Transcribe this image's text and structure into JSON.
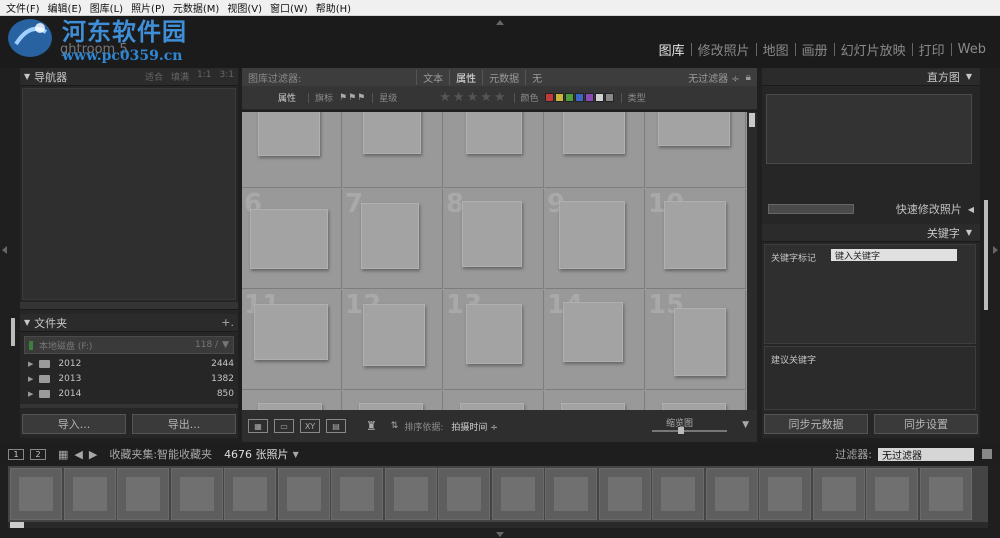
{
  "menu": [
    "文件(F)",
    "编辑(E)",
    "图库(L)",
    "照片(P)",
    "元数据(M)",
    "视图(V)",
    "窗口(W)",
    "帮助(H)"
  ],
  "logo": {
    "title": "河东软件园",
    "sub": "ghtroom 5",
    "url": "www.pc0359.cn"
  },
  "modules": [
    {
      "label": "图库",
      "active": true
    },
    {
      "label": "修改照片"
    },
    {
      "label": "地图"
    },
    {
      "label": "画册"
    },
    {
      "label": "幻灯片放映"
    },
    {
      "label": "打印"
    },
    {
      "label": "Web"
    }
  ],
  "left": {
    "navigator": "导航器",
    "nav_opts": [
      "适合",
      "填满",
      "1:1",
      "3:1"
    ],
    "folders": "文件夹",
    "volume": {
      "label": "本地磁盘 (F:)",
      "count": "118 /"
    },
    "folder_list": [
      {
        "name": "2012",
        "count": "2444"
      },
      {
        "name": "2013",
        "count": "1382"
      },
      {
        "name": "2014",
        "count": "850"
      }
    ],
    "import": "导入...",
    "export": "导出..."
  },
  "filter": {
    "title": "图库过滤器:",
    "tabs": [
      {
        "label": "文本"
      },
      {
        "label": "属性",
        "active": true
      },
      {
        "label": "元数据"
      },
      {
        "label": "无"
      }
    ],
    "preset": "无过滤器 ÷",
    "attr": "属性",
    "flag": "旗标",
    "rating": "星级",
    "color": "颜色",
    "kind": "类型",
    "swatches": [
      "#c03a3a",
      "#c8b63a",
      "#4e9e3e",
      "#3d66c4",
      "#8c4ab5",
      "#d0d0d0",
      "#888888"
    ]
  },
  "grid_numbers": [
    "",
    "",
    "",
    "",
    "",
    "6",
    "7",
    "8",
    "9",
    "10",
    "11",
    "12",
    "13",
    "14",
    "15"
  ],
  "toolbar": {
    "sort_label": "排序依据:",
    "sort_value": "拍摄时间 ÷",
    "thumb": "缩览图",
    "xy": "XY"
  },
  "right": {
    "histogram": "直方图",
    "quick": "快速修改照片",
    "keyword": "关键字",
    "kw_tags": "关键字标记",
    "kw_select": "键入关键字",
    "suggest": "建议关键字",
    "sync_meta": "同步元数据",
    "sync_settings": "同步设置"
  },
  "filmbar": {
    "page1": "1",
    "page2": "2",
    "collection": "收藏夹集:智能收藏夹",
    "count": "4676 张照片",
    "filter_label": "过滤器:",
    "filter_value": "无过滤器"
  }
}
